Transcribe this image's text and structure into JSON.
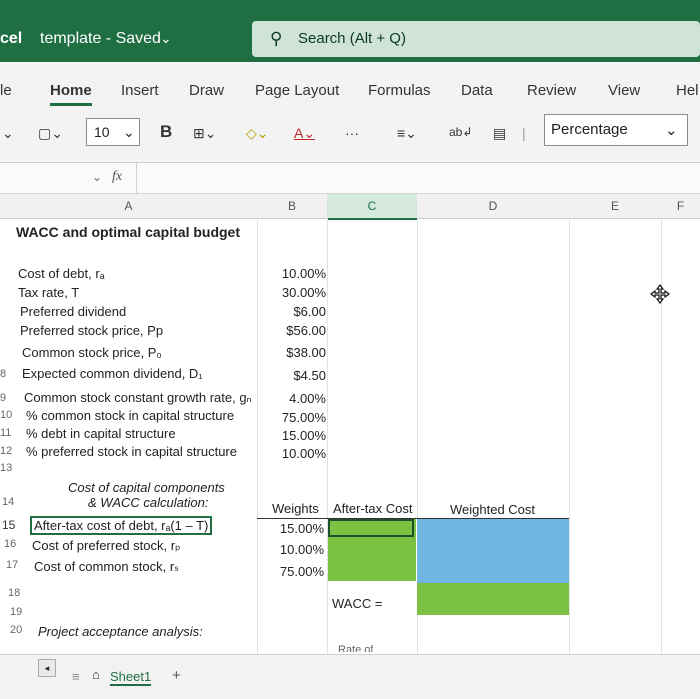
{
  "titlebar": {
    "app_fragment": "cel",
    "doc_title": "template - Saved",
    "chevron": "⌄"
  },
  "search": {
    "icon": "search-icon",
    "placeholder": "Search (Alt + Q)"
  },
  "ribbon": {
    "tabs": [
      "le",
      "Home",
      "Insert",
      "Draw",
      "Page Layout",
      "Formulas",
      "Data",
      "Review",
      "View",
      "Hel"
    ],
    "active_tab": "Home",
    "font_size": "10",
    "bold_label": "B",
    "more_label": "···",
    "number_format": "Percentage"
  },
  "formula_bar": {
    "name_box": "",
    "fx": "fx",
    "content": ""
  },
  "columns": [
    "A",
    "B",
    "C",
    "D",
    "E",
    "F"
  ],
  "sheet": {
    "title": "WACC and optimal capital budget",
    "inputs": [
      {
        "row": "",
        "label": "Cost of debt, rₐ",
        "value": "10.00%"
      },
      {
        "row": "",
        "label": "Tax rate, T",
        "value": "30.00%"
      },
      {
        "row": "",
        "label": "Preferred dividend",
        "value": "$6.00"
      },
      {
        "row": "",
        "label": "Preferred stock price, Pp",
        "value": "$56.00"
      },
      {
        "row": "",
        "label": "Common stock price, P₀",
        "value": "$38.00"
      },
      {
        "row": "8",
        "label": "Expected common dividend, D₁",
        "value": "$4.50"
      },
      {
        "row": "9",
        "label": "Common stock constant growth rate, gₙ",
        "value": "4.00%"
      },
      {
        "row": "10",
        "label": "% common stock in capital structure",
        "value": "75.00%"
      },
      {
        "row": "11",
        "label": "% debt in capital structure",
        "value": "15.00%"
      },
      {
        "row": "12",
        "label": "% preferred stock in capital structure",
        "value": "10.00%"
      }
    ],
    "row13": "13",
    "components_header_line1": "Cost of capital components",
    "components_header_line2": "& WACC calculation:",
    "row14": "14",
    "col_weights": "Weights",
    "col_after_tax": "After-tax Cost",
    "col_weighted": "Weighted Cost",
    "components": [
      {
        "row": "15",
        "label": "After-tax cost of debt, rₐ(1 – T)",
        "weight": "15.00%"
      },
      {
        "row": "16",
        "label": "Cost of preferred stock, rₚ",
        "weight": "10.00%"
      },
      {
        "row": "17",
        "label": "Cost of common stock, rₛ",
        "weight": "75.00%"
      }
    ],
    "row18": "18",
    "wacc_label": "WACC =",
    "row19": "19",
    "row20": "20",
    "project_label": "Project acceptance analysis:",
    "partial_text": "Rate of"
  },
  "sheet_tabs": {
    "active": "Sheet1",
    "add": "+"
  },
  "colors": {
    "green_input": "#7bc142",
    "blue_output": "#6fb6e3",
    "excel_green": "#1f6f43"
  }
}
